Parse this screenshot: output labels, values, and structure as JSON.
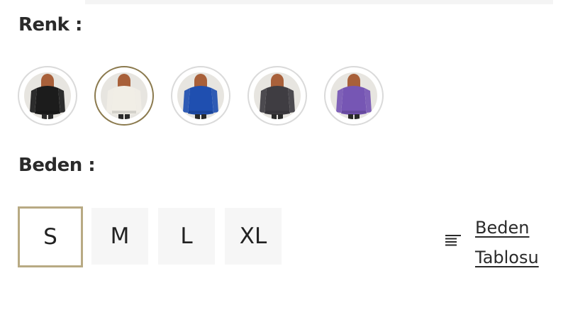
{
  "color_section": {
    "label": "Renk :",
    "swatches": [
      {
        "name": "black",
        "garment_color": "#1c1c1c",
        "selected": false
      },
      {
        "name": "cream",
        "garment_color": "#f1eee6",
        "selected": true
      },
      {
        "name": "blue",
        "garment_color": "#1f4fb0",
        "selected": false
      },
      {
        "name": "anthracite",
        "garment_color": "#3f3d42",
        "selected": false
      },
      {
        "name": "purple",
        "garment_color": "#7656b4",
        "selected": false
      }
    ]
  },
  "size_section": {
    "label": "Beden :",
    "sizes": [
      {
        "label": "S",
        "selected": true
      },
      {
        "label": "M",
        "selected": false
      },
      {
        "label": "L",
        "selected": false
      },
      {
        "label": "XL",
        "selected": false
      }
    ],
    "size_chart": {
      "label": "Beden Tablosu",
      "icon": "text-lines-icon"
    }
  },
  "colors": {
    "selected_swatch_border": "#8b7a4e",
    "selected_size_border": "#b8aa83",
    "size_button_bg": "#f6f6f6",
    "swatch_bg": "#e7e5e0",
    "hair": "#a8603a"
  }
}
